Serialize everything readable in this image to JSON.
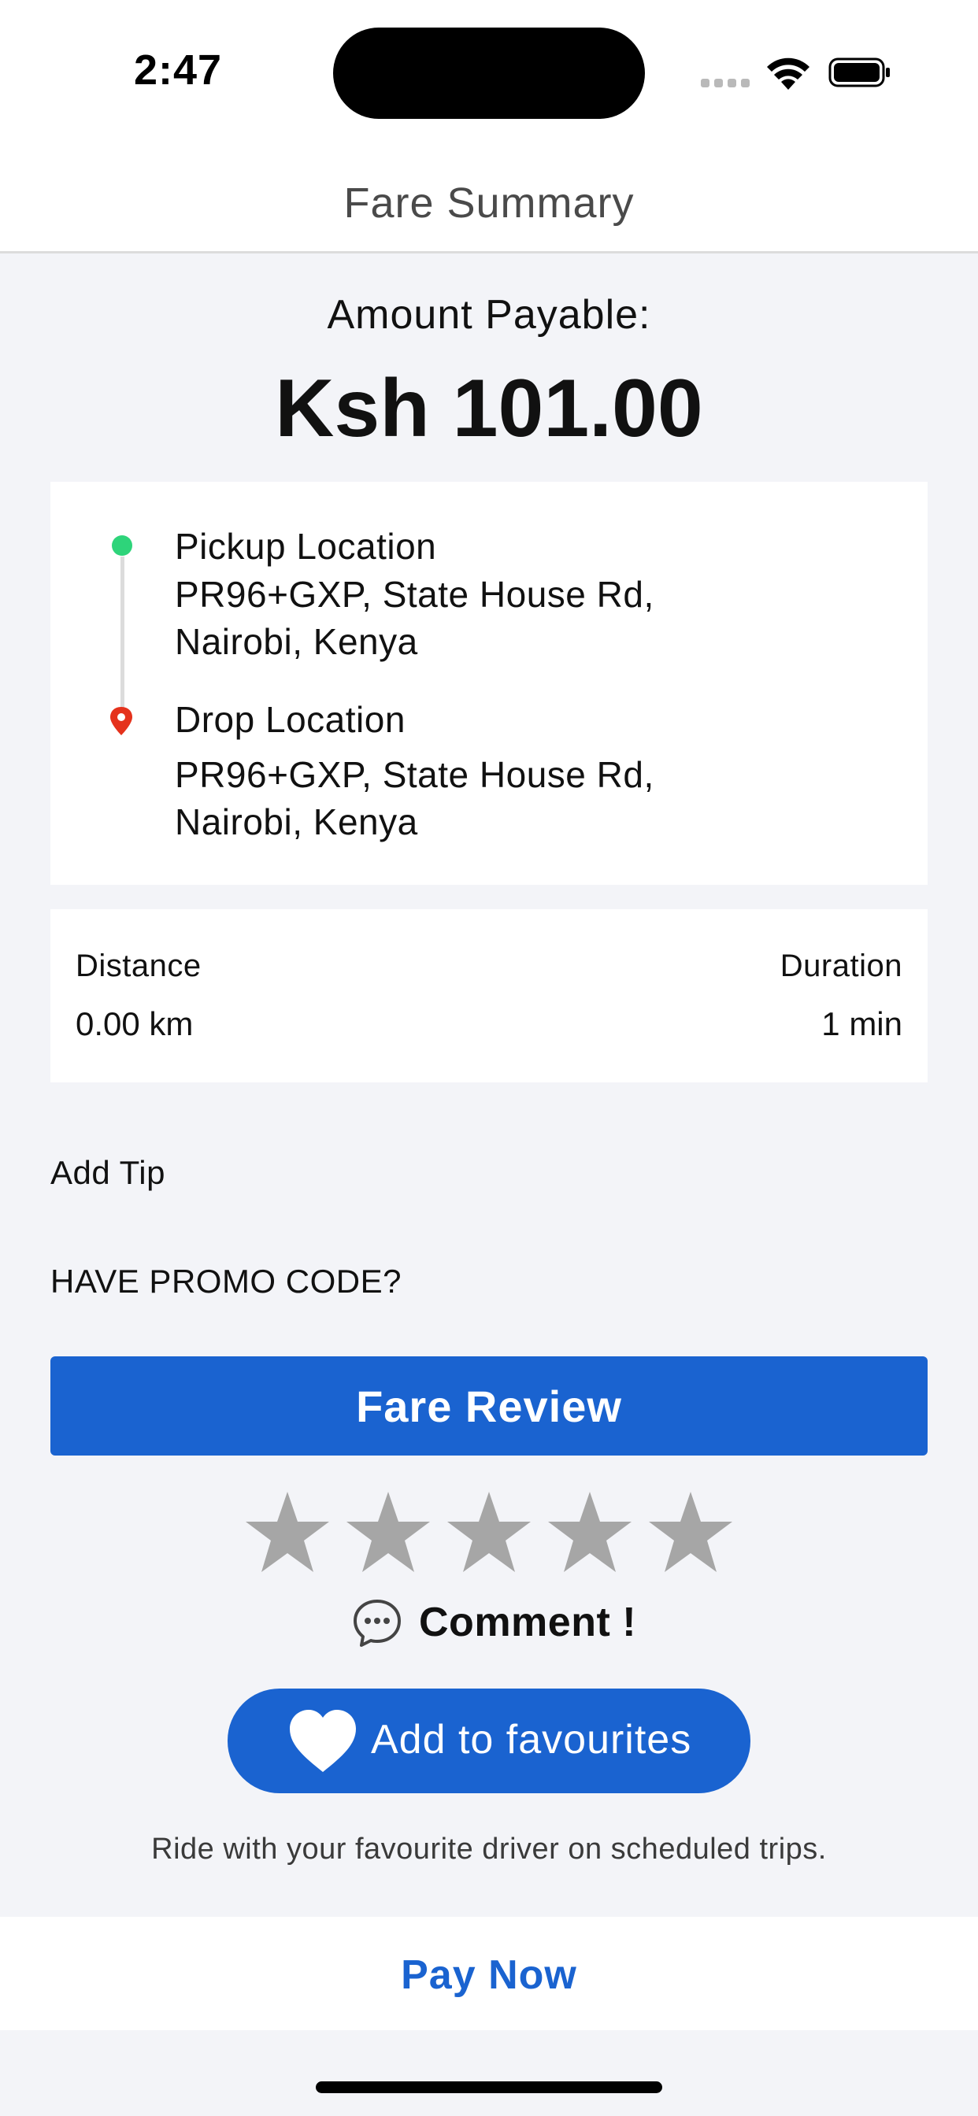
{
  "status_bar": {
    "time": "2:47"
  },
  "header": {
    "title": "Fare Summary"
  },
  "amount": {
    "label": "Amount Payable:",
    "value": "Ksh 101.00"
  },
  "route": {
    "pickup": {
      "title": "Pickup Location",
      "address": "PR96+GXP, State House Rd,\nNairobi, Kenya",
      "dot_color": "#2ed47a"
    },
    "drop": {
      "title": "Drop Location",
      "address": "PR96+GXP, State House Rd,\nNairobi, Kenya",
      "pin_color": "#e5321c"
    }
  },
  "stats": {
    "distance_label": "Distance",
    "distance_value": "0.00 km",
    "duration_label": "Duration",
    "duration_value": "1 min"
  },
  "add_tip": "Add Tip",
  "promo": "HAVE PROMO CODE?",
  "fare_review_label": "Fare Review",
  "rating": {
    "stars_total": 5,
    "stars_selected": 0,
    "star_color": "#a6a6a6"
  },
  "comment_label": "Comment !",
  "favourites": {
    "button_label": "Add to favourites",
    "note": "Ride with your favourite driver on scheduled trips."
  },
  "pay_now_label": "Pay Now",
  "colors": {
    "accent": "#1a63d0",
    "background": "#f3f4f8"
  }
}
